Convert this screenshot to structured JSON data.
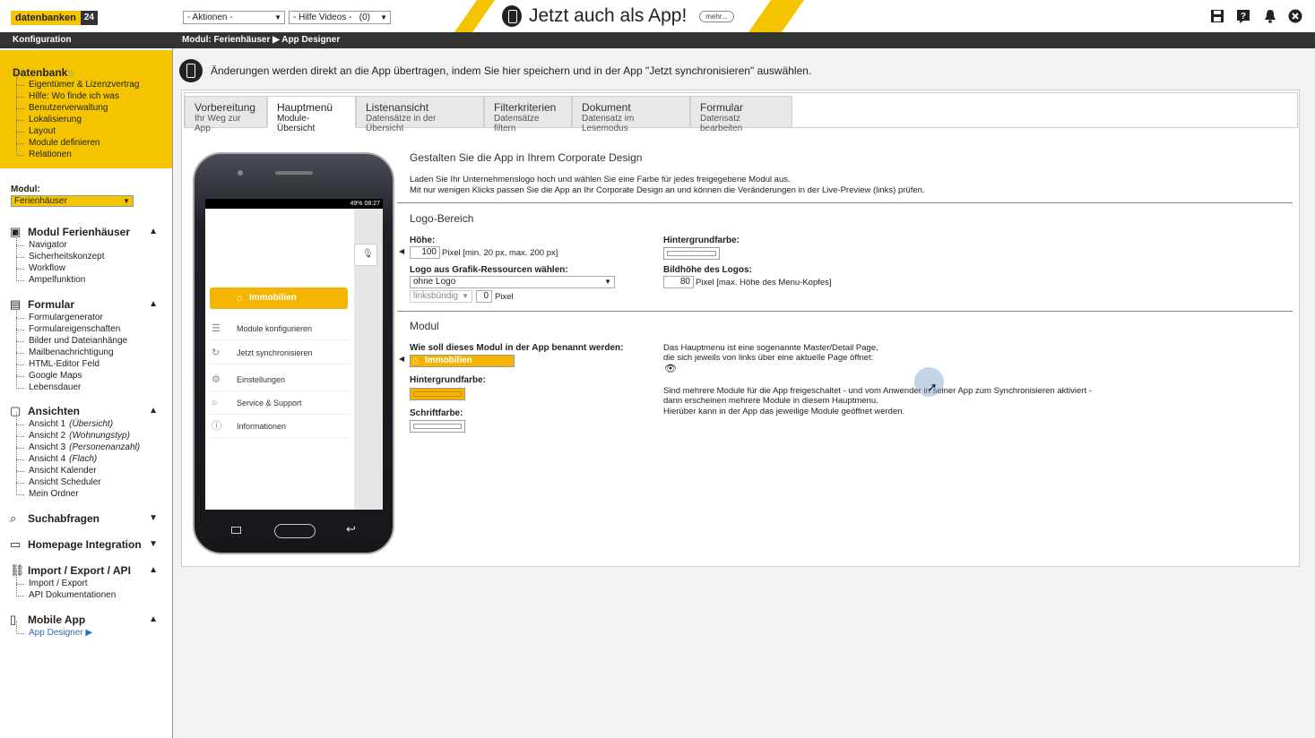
{
  "topbar": {
    "logo_text": "datenbanken",
    "logo_num": "24",
    "actions_select": "- Aktionen -",
    "videos_select": "- Hilfe Videos -",
    "videos_count": "(0)",
    "promo_text": "Jetzt auch als App!",
    "promo_more": "mehr...",
    "icons": [
      "save-icon",
      "help-icon",
      "bell-icon",
      "close-icon"
    ]
  },
  "navbar": {
    "left_title": "Konfiguration",
    "breadcrumb": "Modul: Ferienhäuser ▶ App Designer"
  },
  "sidebar": {
    "db_title": "Datenbank",
    "db_items": [
      "Eigentümer & Lizenzvertrag",
      "Hilfe: Wo finde ich was",
      "Benutzerverwaltung",
      "Lokalisierung",
      "Layout",
      "Module definieren",
      "Relationen"
    ],
    "module_label": "Modul:",
    "module_value": "Ferienhäuser",
    "sections": [
      {
        "title": "Modul Ferienhäuser",
        "arrow": "▲",
        "items": [
          "Navigator",
          "Sicherheitskonzept",
          "Workflow",
          "Ampelfunktion"
        ]
      },
      {
        "title": "Formular",
        "arrow": "▲",
        "items": [
          "Formulargenerator",
          "Formulareigenschaften",
          "Bilder und Dateianhänge",
          "Mailbenachrichtigung",
          "HTML-Editor Feld",
          "Google Maps",
          "Lebensdauer"
        ]
      },
      {
        "title": "Ansichten",
        "arrow": "▲",
        "items": [
          "Ansicht 1",
          "Ansicht 2",
          "Ansicht 3",
          "Ansicht 4",
          "Ansicht Kalender",
          "Ansicht Scheduler",
          "Mein Ordner"
        ],
        "notes": [
          "(Übersicht)",
          "(Wohnungstyp)",
          "(Personenanzahl)",
          "(Flach)"
        ]
      },
      {
        "title": "Suchabfragen",
        "arrow": "▼",
        "items": []
      },
      {
        "title": "Homepage Integration",
        "arrow": "▼",
        "items": []
      },
      {
        "title": "Import / Export / API",
        "arrow": "▲",
        "items": [
          "Import / Export",
          "API Dokumentationen"
        ]
      },
      {
        "title": "Mobile App",
        "arrow": "▲",
        "items": [
          "App Designer ▶"
        ]
      }
    ]
  },
  "info": {
    "text": "Änderungen werden direkt an die App übertragen, indem Sie hier speichern und in der App \"Jetzt synchronisieren\" auswählen."
  },
  "tabs": [
    {
      "l1": "Vorbereitung",
      "l2": "Ihr Weg zur App"
    },
    {
      "l1": "Hauptmenü",
      "l2": "Module-Übersicht"
    },
    {
      "l1": "Listenansicht",
      "l2": "Datensätze in der Übersicht"
    },
    {
      "l1": "Filterkriterien",
      "l2": "Datensätze filtern"
    },
    {
      "l1": "Dokument",
      "l2": "Datensatz im Lesemodus"
    },
    {
      "l1": "Formular",
      "l2": "Datensatz bearbeiten"
    }
  ],
  "phone": {
    "status": "49% 08:27",
    "highlight": "Immobilien",
    "menu": [
      "Module konfigurieren",
      "Jetzt synchronisieren",
      "Einstellungen",
      "Service & Support",
      "Informationen"
    ]
  },
  "form": {
    "heading": "Gestalten Sie die App in Ihrem Corporate Design",
    "intro1": "Laden Sie Ihr Unternehmenslogo hoch und wählen Sie eine Farbe für jedes freigegebene Modul aus.",
    "intro2": "Mit nur wenigen Klicks passen Sie die App an Ihr Corporate Design an und können die Veränderungen in der Live-Preview (links) prüfen.",
    "logo_section": "Logo-Bereich",
    "height_label": "Höhe:",
    "height_value": "100",
    "height_hint": "Pixel [min. 20 px, max. 200 px]",
    "bg_label": "Hintergrundfarbe:",
    "logo_select_label": "Logo aus Grafik-Ressourcen wählen:",
    "logo_select_value": "ohne Logo",
    "align_value": "linksbündig",
    "offset_value": "0",
    "offset_unit": "Pixel",
    "logo_height_label": "Bildhöhe des Logos:",
    "logo_height_value": "80",
    "logo_height_hint": "Pixel [max. Höhe des Menu-Kopfes]",
    "modul_section": "Modul",
    "name_label": "Wie soll dieses Modul in der App benannt werden:",
    "name_value": "Immobilien",
    "mod_bg_label": "Hintergrundfarbe:",
    "font_color_label": "Schriftfarbe:",
    "desc1": "Das Hauptmenu ist eine sogenannte Master/Detail Page,",
    "desc2": "die sich jeweils von links über eine aktuelle Page öffnet:",
    "desc3": "Sind mehrere Module für die App freigeschaltet - und vom Anwender in seiner App zum Synchronisieren aktiviert -",
    "desc4": "dann erscheinen mehrere Module in diesem Hauptmenu.",
    "desc5": "Hierüber kann in der App das jeweilige Module geöffnet werden."
  },
  "colors": {
    "accent": "#f5c400",
    "dark": "#333333",
    "orange": "#f5b400"
  }
}
